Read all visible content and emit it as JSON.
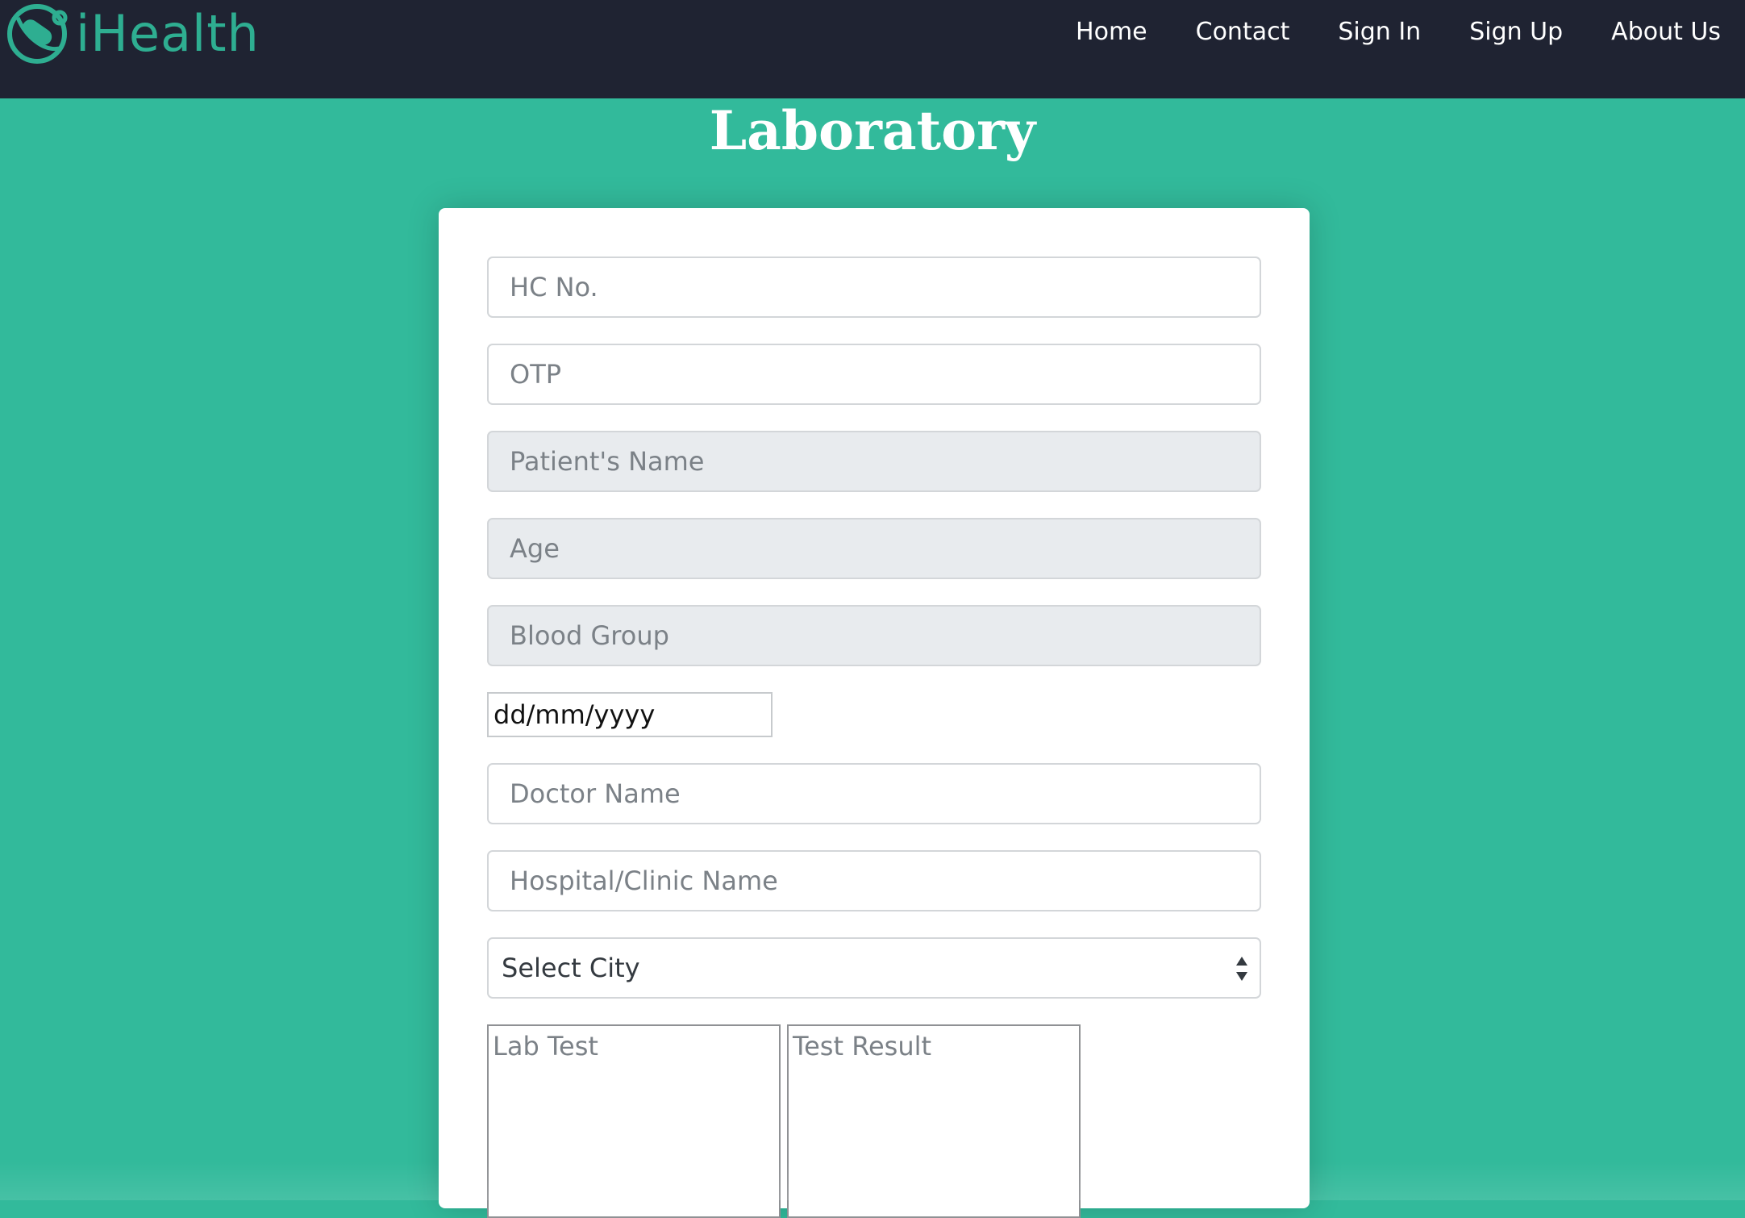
{
  "brand": {
    "name": "iHealth",
    "logo_icon": "stethoscope-pill-icon",
    "color": "#2EAE91"
  },
  "nav": {
    "items": [
      {
        "label": "Home"
      },
      {
        "label": "Contact"
      },
      {
        "label": "Sign In"
      },
      {
        "label": "Sign Up"
      },
      {
        "label": "About Us"
      }
    ]
  },
  "page": {
    "title": "Laboratory",
    "background": "#32BA9B",
    "navbar_color": "#1F2332"
  },
  "form": {
    "hc_no": {
      "placeholder": "HC No.",
      "value": ""
    },
    "otp": {
      "placeholder": "OTP",
      "value": ""
    },
    "patient_name": {
      "placeholder": "Patient's Name",
      "value": "",
      "disabled": true
    },
    "age": {
      "placeholder": "Age",
      "value": "",
      "disabled": true
    },
    "blood_group": {
      "placeholder": "Blood Group",
      "value": "",
      "disabled": true
    },
    "date": {
      "display": "dd/mm/yyyy"
    },
    "doctor_name": {
      "placeholder": "Doctor Name",
      "value": ""
    },
    "hospital_name": {
      "placeholder": "Hospital/Clinic Name",
      "value": ""
    },
    "city": {
      "selected": "Select City"
    },
    "lab_test": {
      "placeholder": "Lab Test",
      "value": ""
    },
    "test_result": {
      "placeholder": "Test Result",
      "value": ""
    }
  }
}
